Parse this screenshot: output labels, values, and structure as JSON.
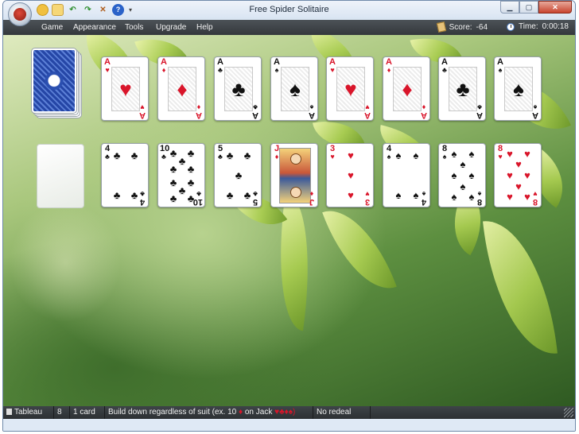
{
  "window": {
    "title": "Free Spider Solitaire"
  },
  "quick_access": [
    {
      "name": "new-game-icon",
      "glyph": ""
    },
    {
      "name": "open-icon",
      "glyph": ""
    },
    {
      "name": "undo-icon",
      "glyph": "↶"
    },
    {
      "name": "redo-icon",
      "glyph": "↷"
    },
    {
      "name": "hint-icon",
      "glyph": "✕"
    },
    {
      "name": "help-icon",
      "glyph": "?"
    },
    {
      "name": "customize-icon",
      "glyph": "▾"
    }
  ],
  "menu": {
    "game": "Game",
    "appearance": "Appearance",
    "tools": "Tools",
    "upgrade": "Upgrade",
    "help": "Help"
  },
  "score": {
    "label": "Score:",
    "value": "-64"
  },
  "time": {
    "label": "Time:",
    "value": "0:00:18"
  },
  "foundations": [
    {
      "rank": "A",
      "suit": "♥",
      "color": "red"
    },
    {
      "rank": "A",
      "suit": "♦",
      "color": "red"
    },
    {
      "rank": "A",
      "suit": "♣",
      "color": "black"
    },
    {
      "rank": "A",
      "suit": "♠",
      "color": "black"
    },
    {
      "rank": "A",
      "suit": "♥",
      "color": "red"
    },
    {
      "rank": "A",
      "suit": "♦",
      "color": "red"
    },
    {
      "rank": "A",
      "suit": "♣",
      "color": "black"
    },
    {
      "rank": "A",
      "suit": "♠",
      "color": "black"
    }
  ],
  "tableau": [
    {
      "rank": "4",
      "suit": "♣",
      "color": "black"
    },
    {
      "rank": "10",
      "suit": "♣",
      "color": "black"
    },
    {
      "rank": "5",
      "suit": "♣",
      "color": "black"
    },
    {
      "rank": "J",
      "suit": "♦",
      "color": "red"
    },
    {
      "rank": "3",
      "suit": "♥",
      "color": "red"
    },
    {
      "rank": "4",
      "suit": "♠",
      "color": "black"
    },
    {
      "rank": "8",
      "suit": "♠",
      "color": "black"
    },
    {
      "rank": "8",
      "suit": "♥",
      "color": "red"
    }
  ],
  "status": {
    "tableau": "Tableau",
    "count": "8",
    "cards": "1 card",
    "rule_prefix": "Build down regardless of suit (ex. 10",
    "rule_suit1": "♦",
    "rule_mid": "on Jack",
    "rule_suits": "♥♣♦♠)",
    "redeal": "No redeal"
  },
  "colors": {
    "red": "#d9152a",
    "black": "#111111",
    "menubar": "#3e4448",
    "felt_green": "#5d8f40"
  }
}
